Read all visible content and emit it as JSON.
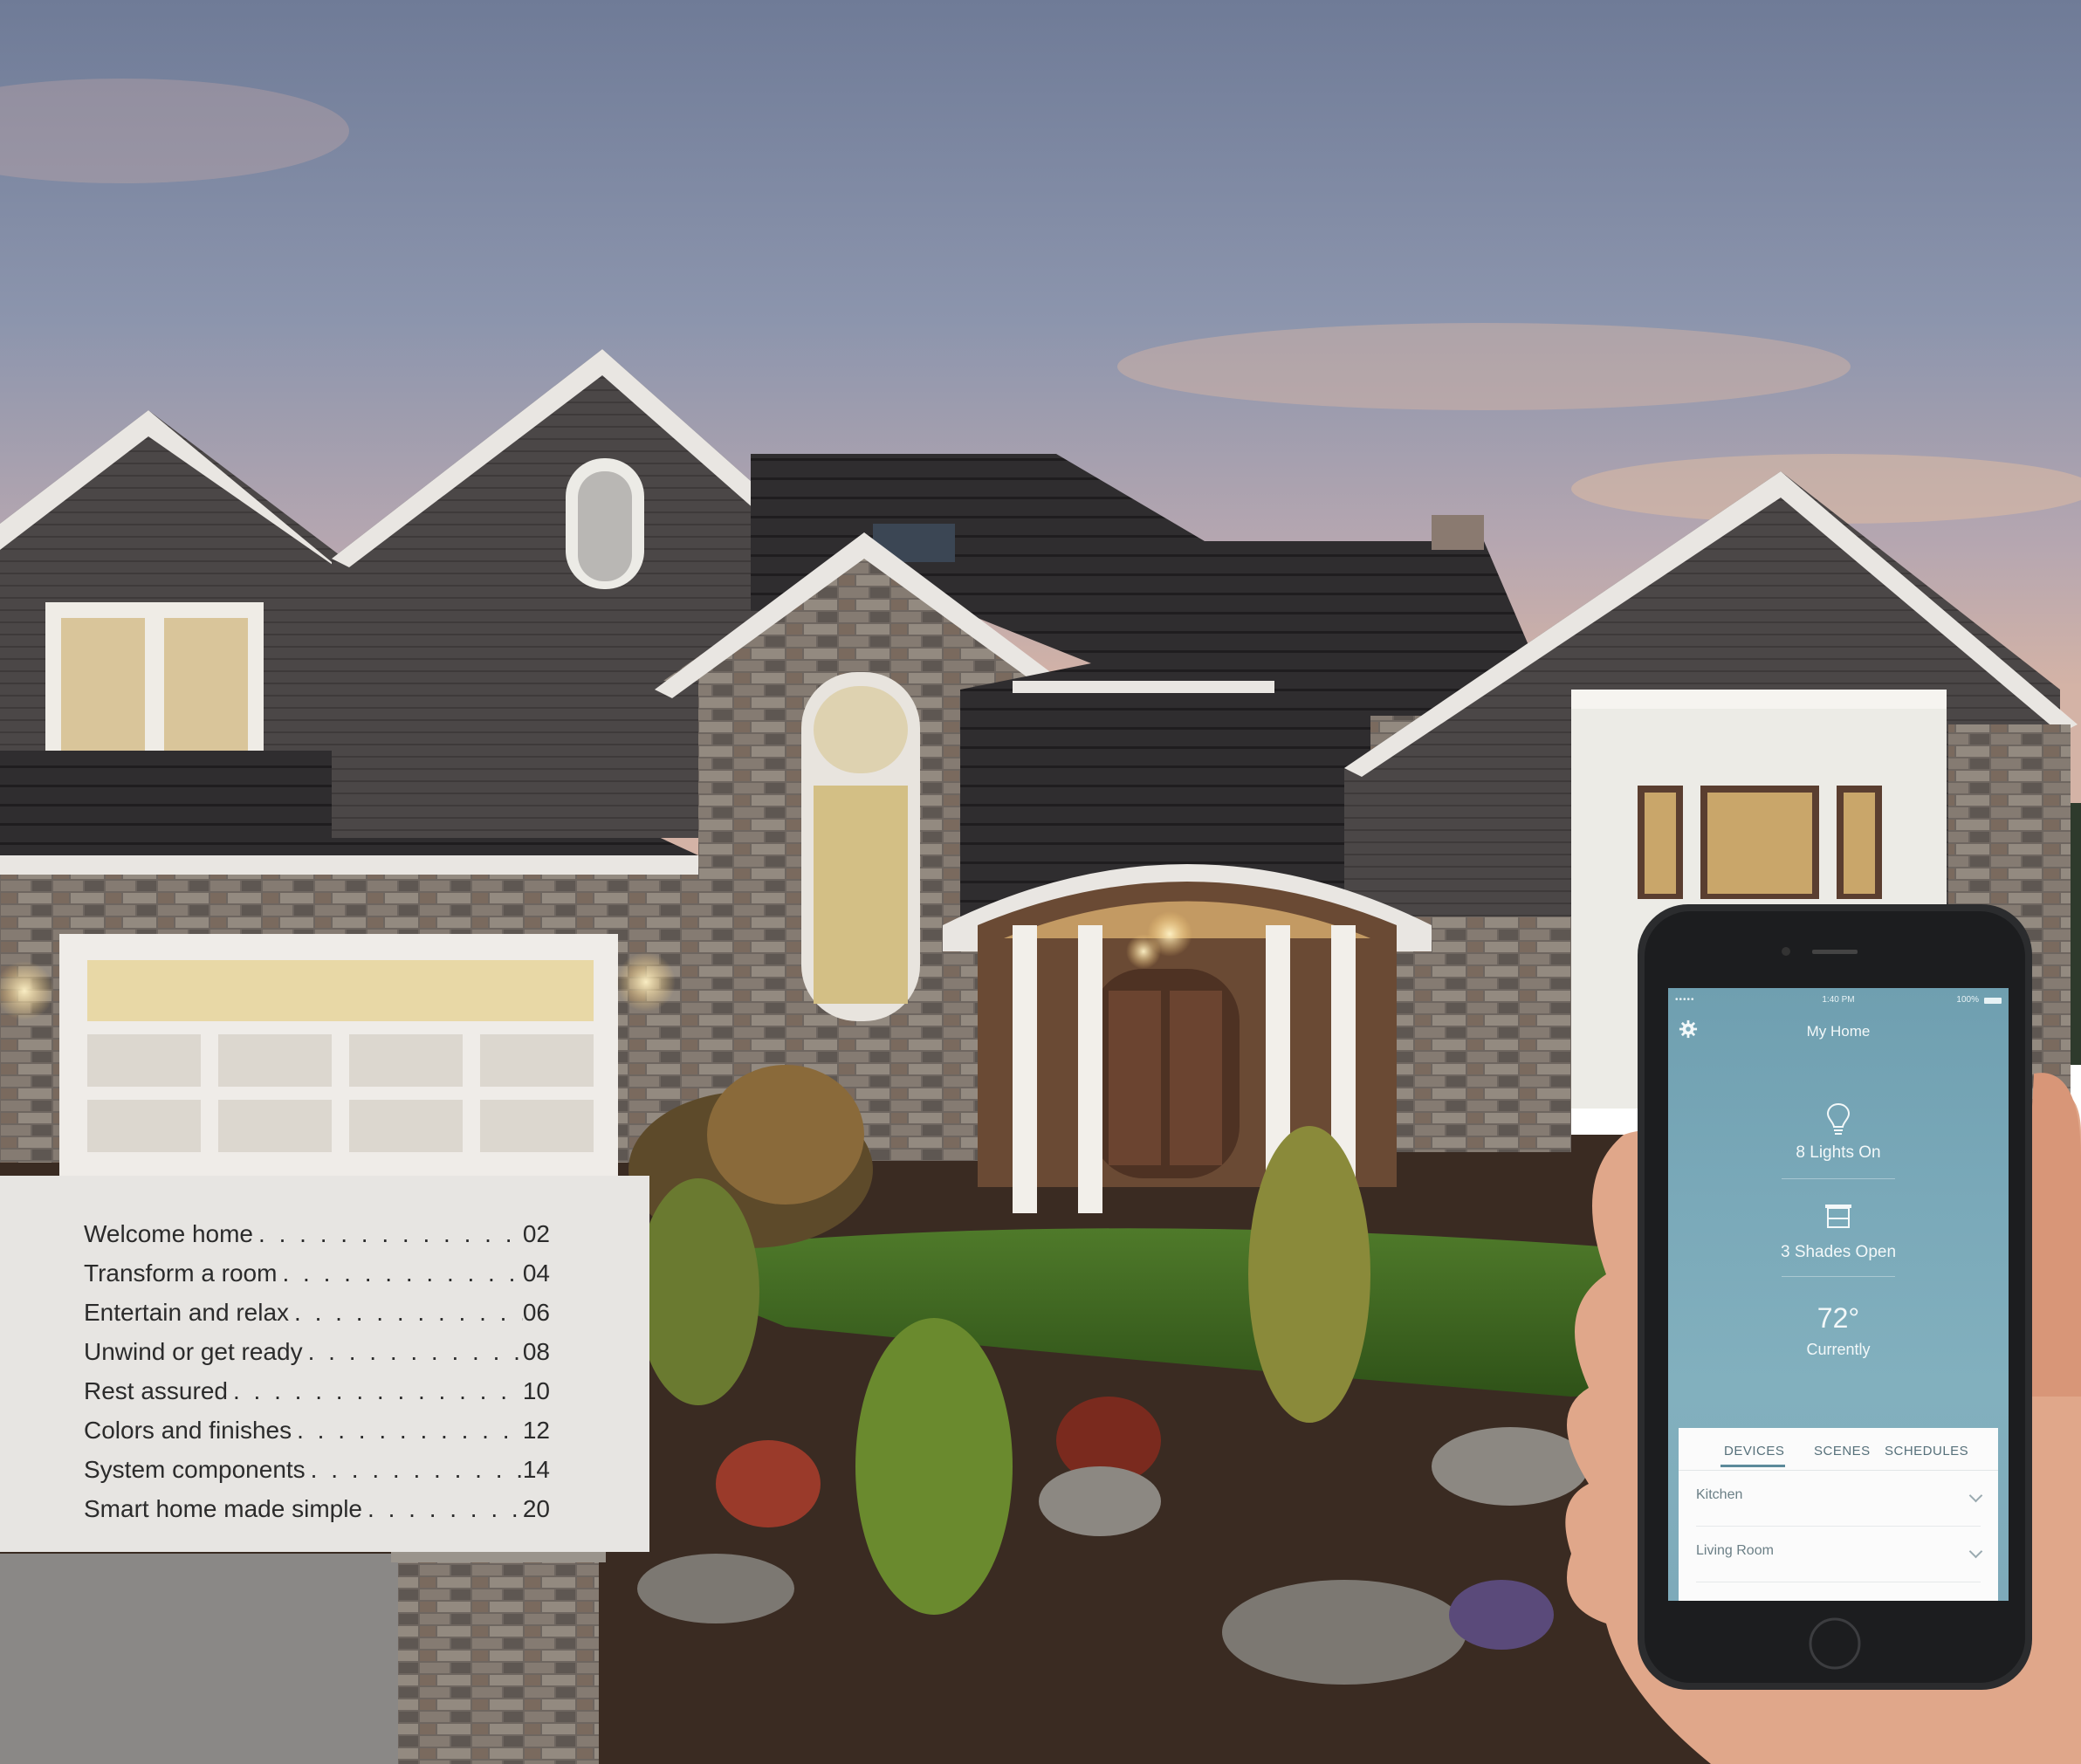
{
  "toc": {
    "items": [
      {
        "title": "Welcome home",
        "page": "02"
      },
      {
        "title": "Transform a room",
        "page": "04"
      },
      {
        "title": "Entertain and relax",
        "page": "06"
      },
      {
        "title": "Unwind or get ready",
        "page": "08"
      },
      {
        "title": "Rest assured",
        "page": "10"
      },
      {
        "title": "Colors and finishes",
        "page": "12"
      },
      {
        "title": "System components",
        "page": "14"
      },
      {
        "title": "Smart home made simple",
        "page": "20"
      }
    ]
  },
  "phone": {
    "status_signal": "••••• ",
    "status_time": "1:40 PM",
    "status_battery": "100%",
    "title": "My Home",
    "lights_status": "8 Lights On",
    "shades_status": "3 Shades Open",
    "temperature": "72°",
    "temperature_label": "Currently",
    "tabs": [
      "DEVICES",
      "SCENES",
      "SCHEDULES"
    ],
    "rooms": [
      "Kitchen",
      "Living Room"
    ],
    "icons": [
      "gear-icon",
      "lightbulb-icon",
      "shade-icon",
      "chevron-down-icon"
    ]
  },
  "colors": {
    "sky_top": "#7d8aa3",
    "house_siding": "#4a4646",
    "toc_background": "#e7e5e2",
    "screen_blue": "#7aa9b9"
  }
}
